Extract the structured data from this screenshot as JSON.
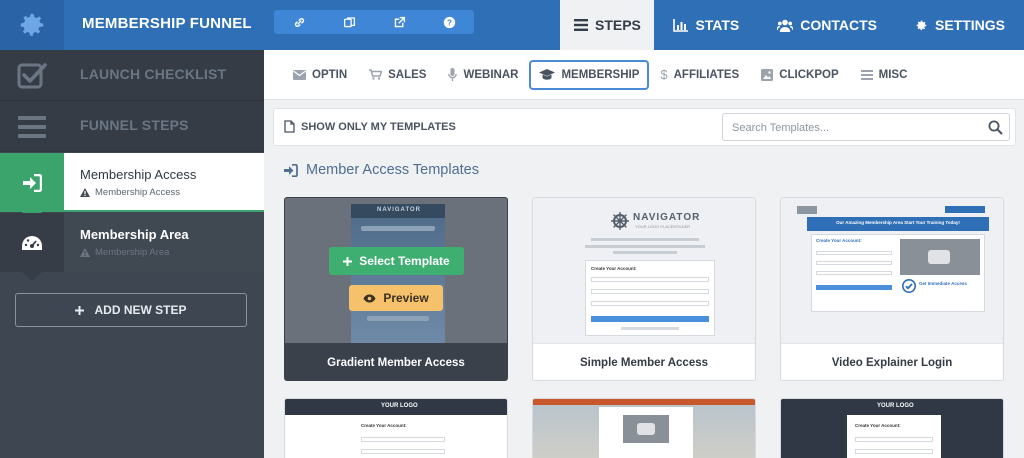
{
  "header": {
    "funnel_title": "MEMBERSHIP FUNNEL",
    "tools": [
      "link-icon",
      "copy-icon",
      "external-link-icon",
      "help-icon"
    ],
    "nav": [
      {
        "label": "STEPS",
        "icon": "steps-list-icon",
        "active": true
      },
      {
        "label": "STATS",
        "icon": "bar-chart-icon",
        "active": false
      },
      {
        "label": "CONTACTS",
        "icon": "users-icon",
        "active": false
      },
      {
        "label": "SETTINGS",
        "icon": "gear-icon",
        "active": false
      }
    ]
  },
  "sidebar": {
    "launch_checklist": "LAUNCH CHECKLIST",
    "funnel_steps": "FUNNEL STEPS",
    "steps": [
      {
        "name": "Membership Access",
        "sub": "Membership Access",
        "icon": "sign-in-icon",
        "active": true
      },
      {
        "name": "Membership Area",
        "sub": "Membership Area",
        "icon": "dashboard-icon",
        "active": false
      }
    ],
    "add_step": "ADD NEW STEP"
  },
  "categories": [
    {
      "label": "OPTIN",
      "icon": "envelope-icon",
      "active": false
    },
    {
      "label": "SALES",
      "icon": "cart-icon",
      "active": false
    },
    {
      "label": "WEBINAR",
      "icon": "microphone-icon",
      "active": false
    },
    {
      "label": "MEMBERSHIP",
      "icon": "graduation-cap-icon",
      "active": true
    },
    {
      "label": "AFFILIATES",
      "icon": "dollar-icon",
      "active": false
    },
    {
      "label": "CLICKPOP",
      "icon": "image-icon",
      "active": false
    },
    {
      "label": "MISC",
      "icon": "list-icon",
      "active": false
    }
  ],
  "filter": {
    "only_mine": "SHOW ONLY MY TEMPLATES",
    "search_placeholder": "Search Templates..."
  },
  "section_title": "Member Access Templates",
  "templates": [
    {
      "name": "Gradient Member Access",
      "hover": true,
      "select_label": "Select Template",
      "preview_label": "Preview"
    },
    {
      "name": "Simple Member Access"
    },
    {
      "name": "Video Explainer Login"
    }
  ],
  "thumb_text": {
    "navigator": "NAVIGATOR",
    "logo_placeholder": "YOUR LOGO PLACEHOLDER",
    "your_logo": "YOUR LOGO",
    "create_account": "Create Your Account:",
    "amazing_headline": "Our Amazing Membership Area Start Your Training Today!",
    "get_access": "Get Immediate Access"
  },
  "colors": {
    "topbar": "#2f6fb6",
    "sidebar": "#3e4652",
    "active_green": "#3aa46c",
    "select_green": "#3fae71",
    "preview_yellow": "#f5c26b",
    "active_tab_border": "#4b8bd6"
  }
}
